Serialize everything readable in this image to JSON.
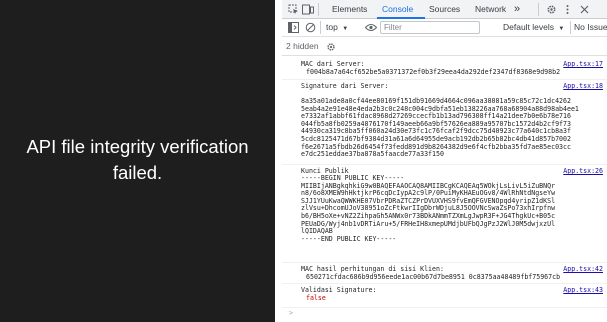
{
  "app": {
    "message": "API file integrity verification failed.",
    "background": "#1e1e1e"
  },
  "devtools": {
    "tabs": [
      {
        "label": "Elements",
        "active": false
      },
      {
        "label": "Console",
        "active": true
      },
      {
        "label": "Sources",
        "active": false
      },
      {
        "label": "Network",
        "active": false
      }
    ],
    "more_tabs": "»",
    "toolbar": {
      "context": "top",
      "filter_placeholder": "Filter",
      "levels": "Default levels",
      "issues": "No Issues"
    },
    "hidden_count": "2 hidden",
    "accent": "#1a73e8",
    "link_color": "#1a0dab",
    "false_color": "#c80000"
  },
  "console": [
    {
      "label": "MAC dari Server:",
      "source": "App.tsx:17",
      "value": "f004b8a7a64cf652be5a0371372ef0b3f29eea4da292def2347df8368e9d98b2"
    },
    {
      "label": "Signature dari Server:",
      "source": "App.tsx:18",
      "value": "8a35a01ade8a0cf44ee80169f151db91669d4664c096aa38081a59c85c72c1dc4262\n5eab4a2e91e48e4eda2b3c0c248c004c9dbfa51eb138226aa768a68904a88d98ab4ee1\ne7332af1abbf61fdac8968d27269ccecfb1b13ad796308ff14a21dee7b0e6b78e716\n044fb5a8fb0259a4876170f149aeeb66a9bf57626ea889a95707bc1572d4b2cf9f73\n44930ca319c8ba5ff060a24d30e73fc1c76fcaf2f9dcc75d40923c77a640c1cb8a3f\n5cdc8125471d67bf9384d31a61a6d64955de9acb192db2b65b82bc4db41d857b7002\nf6e2671a5fbdb26d6454f73fedd891d9b8264382d9e6f4cfb2bba35fd7ae85ec03cc\ne7dc251eddae37ba878a5faacde77a33f150"
    },
    {
      "label": "Kunci Publik",
      "source": "App.tsx:26",
      "value": "-----BEGIN PUBLIC KEY-----\nMIIBIjANBgkqhkiG9w0BAQEFAAOCAQ8AMIIBCgKCAQEAq5WOkjLsLivL5iZuBNQr\nn8/6o8XMEW9hHktjkrP6cqDcIypA2c9lP/0PuiMyKHAEuOGv8/4WlRhNtdNgseYw\nSJJ1YUuKwaQWWKHE07VbrPDRaZTCZPrDVUXVHS9fvEmQFGVENOpqd4yripZ1dKSl\nzlVsu+DhcomUJoV38951oZcFtkwrIIgDbrWDjuL8J5OOVNcSwaZsPo73xhIrpfnw\nb6/BH5oXe+vNZ2ZihpaGh5ANWx0r73BDkANmmTZXmLgJwpR3F+JG4ThgkUc+B05c\nPEUaDG/Wyj4nb1vDRTiAru+5/FRHeIH8xmepUMdjbUFbQJgPzJ2WlJ0M5dwjxzUl\nlQIDAQAB\n-----END PUBLIC KEY-----"
    },
    {
      "label": "MAC hasil perhitungan di sisi Klien:",
      "source": "App.tsx:42",
      "value": "650271cfdac686b9d956eede1ac00b67d7be8951 0c8375aa48489fbf75967cb"
    },
    {
      "label": "Validasi Signature:",
      "source": "App.tsx:43",
      "value": "false"
    }
  ]
}
